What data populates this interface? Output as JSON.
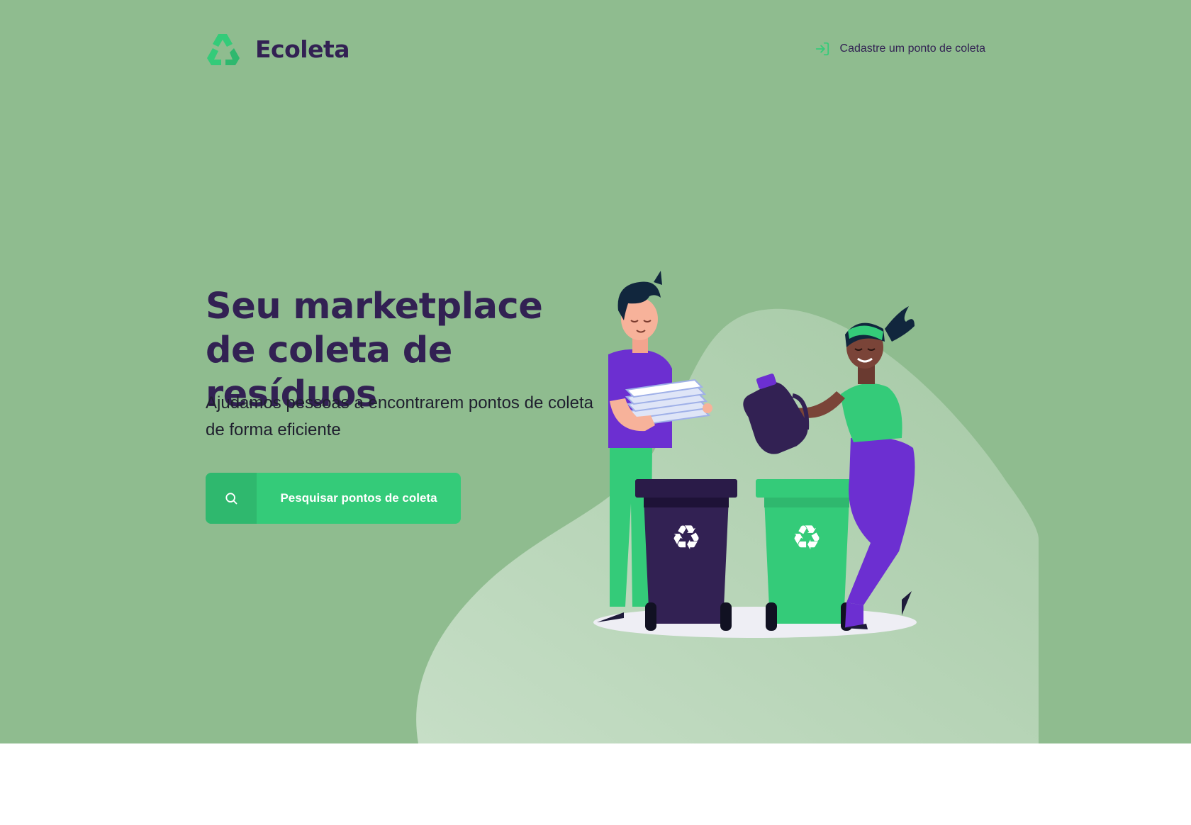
{
  "header": {
    "app_name": "Ecoleta",
    "logo_icon": "recycle-logo-icon",
    "register_link_label": "Cadastre um ponto de coleta",
    "register_link_icon": "log-in-icon"
  },
  "hero": {
    "title": "Seu marketplace de coleta de resíduos",
    "subtitle": "Ajudamos pessoas a encontrarem pontos de coleta de forma eficiente",
    "search_button_label": "Pesquisar pontos de coleta",
    "search_button_icon": "search-icon",
    "illustration": "people-recycling-illustration"
  },
  "colors": {
    "hero_background": "#8fbc8f",
    "primary_green": "#34cb79",
    "dark_green": "#2fb86e",
    "title_purple": "#322153",
    "accent_purple": "#6c2fd1"
  }
}
